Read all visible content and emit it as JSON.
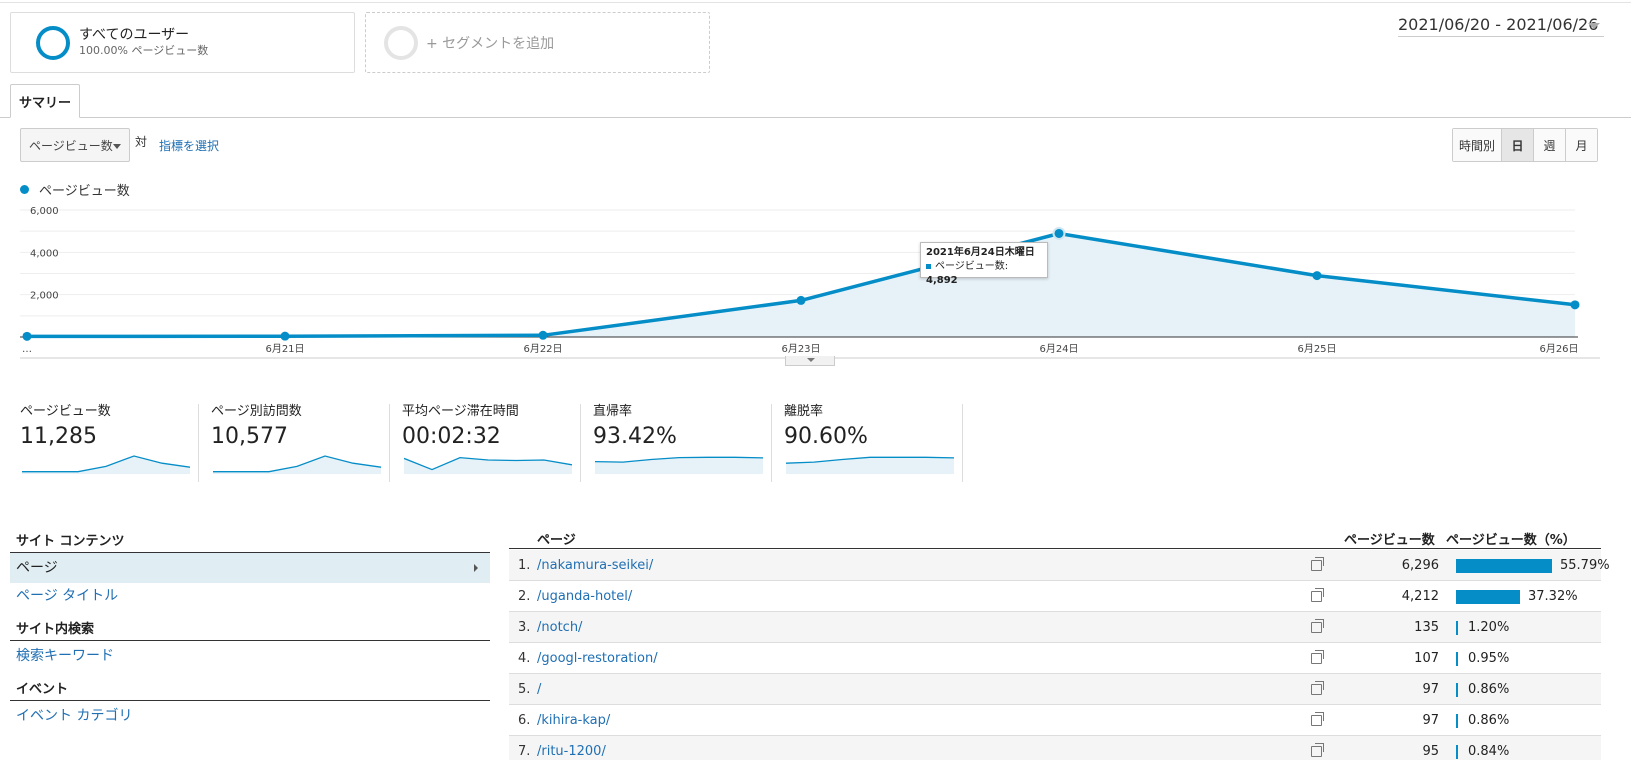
{
  "segments": {
    "all": {
      "title": "すべてのユーザー",
      "sub": "100.00% ページビュー数"
    },
    "add": {
      "label": "+ セグメントを追加"
    }
  },
  "date_range": "2021/06/20 - 2021/06/26",
  "tab": "サマリー",
  "toolbar": {
    "metric_select": "ページビュー数",
    "vs": "対",
    "choose_metric": "指標を選択",
    "intervals": [
      "時間別",
      "日",
      "週",
      "月"
    ],
    "active_interval": "日"
  },
  "legend": "ページビュー数",
  "colors": {
    "accent": "#058dc7",
    "link": "#1f6fb3",
    "area": "#e6f2f8"
  },
  "chart_data": {
    "type": "area",
    "categories": [
      "…",
      "6月21日",
      "6月22日",
      "6月23日",
      "6月24日",
      "6月25日",
      "6月26日"
    ],
    "values": [
      30,
      40,
      80,
      1730,
      4892,
      2900,
      1520
    ],
    "yticks": [
      "6,000",
      "4,000",
      "2,000"
    ],
    "ylim": [
      0,
      6000
    ],
    "grid": true,
    "tooltip": {
      "title": "2021年6月24日木曜日",
      "label": "ページビュー数:",
      "value": "4,892"
    }
  },
  "scorecards": [
    {
      "label": "ページビュー数",
      "value": "11,285",
      "spark": [
        0.02,
        0.02,
        0.02,
        0.35,
        1.0,
        0.55,
        0.3
      ]
    },
    {
      "label": "ページ別訪問数",
      "value": "10,577",
      "spark": [
        0.02,
        0.02,
        0.02,
        0.35,
        1.0,
        0.55,
        0.3
      ]
    },
    {
      "label": "平均ページ滞在時間",
      "value": "00:02:32",
      "spark": [
        0.85,
        0.15,
        0.9,
        0.75,
        0.72,
        0.75,
        0.45
      ]
    },
    {
      "label": "直帰率",
      "value": "93.42%",
      "spark": [
        0.65,
        0.62,
        0.78,
        0.9,
        0.92,
        0.92,
        0.88
      ]
    },
    {
      "label": "離脱率",
      "value": "90.60%",
      "spark": [
        0.55,
        0.62,
        0.78,
        0.92,
        0.92,
        0.92,
        0.88
      ]
    }
  ],
  "nav": {
    "site_content": "サイト コンテンツ",
    "page": "ページ",
    "page_title": "ページ タイトル",
    "site_search": "サイト内検索",
    "search_keyword": "検索キーワード",
    "events": "イベント",
    "event_category": "イベント カテゴリ"
  },
  "table": {
    "headers": {
      "page": "ページ",
      "pageviews": "ページビュー数",
      "pct": "ページビュー数（%）"
    },
    "rows": [
      {
        "num": "1.",
        "page": "/nakamura-seikei/",
        "pv": "6,296",
        "pct": "55.79%",
        "frac": 0.5579
      },
      {
        "num": "2.",
        "page": "/uganda-hotel/",
        "pv": "4,212",
        "pct": "37.32%",
        "frac": 0.3732
      },
      {
        "num": "3.",
        "page": "/notch/",
        "pv": "135",
        "pct": "1.20%",
        "frac": 0.012
      },
      {
        "num": "4.",
        "page": "/googl-restoration/",
        "pv": "107",
        "pct": "0.95%",
        "frac": 0.0095
      },
      {
        "num": "5.",
        "page": "/",
        "pv": "97",
        "pct": "0.86%",
        "frac": 0.0086
      },
      {
        "num": "6.",
        "page": "/kihira-kap/",
        "pv": "97",
        "pct": "0.86%",
        "frac": 0.0086
      },
      {
        "num": "7.",
        "page": "/ritu-1200/",
        "pv": "95",
        "pct": "0.84%",
        "frac": 0.0084
      }
    ]
  }
}
